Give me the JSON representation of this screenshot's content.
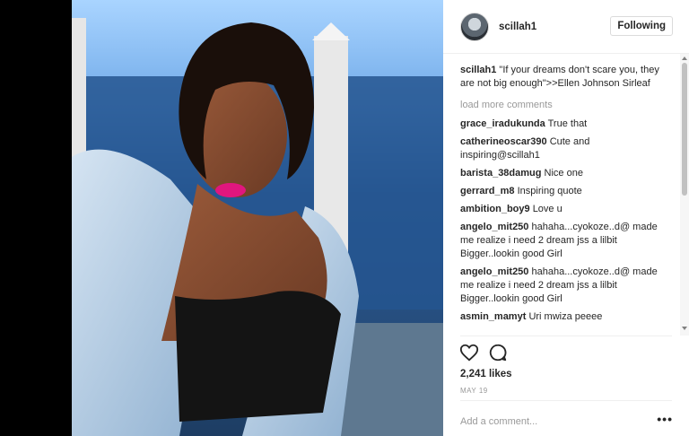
{
  "post": {
    "username": "scillah1",
    "follow_label": "Following",
    "caption": {
      "user": "scillah1",
      "text": "\"If your dreams don't scare you, they are not big enough\">>Ellen Johnson Sirleaf"
    },
    "load_more": "load more comments",
    "comments": [
      {
        "user": "grace_iradukunda",
        "text": "True that"
      },
      {
        "user": "catherineoscar390",
        "text": "Cute and inspiring@scillah1"
      },
      {
        "user": "barista_38damug",
        "text": "Nice one"
      },
      {
        "user": "gerrard_m8",
        "text": "Inspiring quote"
      },
      {
        "user": "ambition_boy9",
        "text": "Love u"
      },
      {
        "user": "angelo_mit250",
        "text": "hahaha...cyokoze..d@ made me realize i need 2 dream jss a lilbit Bigger..lookin good Girl"
      },
      {
        "user": "angelo_mit250",
        "text": "hahaha...cyokoze..d@ made me realize i need 2 dream jss a lilbit Bigger..lookin good Girl"
      },
      {
        "user": "asmin_mamyt",
        "text": "Uri mwiza peeee"
      }
    ],
    "likes": "2,241 likes",
    "date": "MAY 19",
    "add_comment_placeholder": "Add a comment...",
    "more_label": "•••"
  },
  "colors": {
    "accent_lips": "#e0167e",
    "text": "#262626",
    "muted": "#999999"
  }
}
